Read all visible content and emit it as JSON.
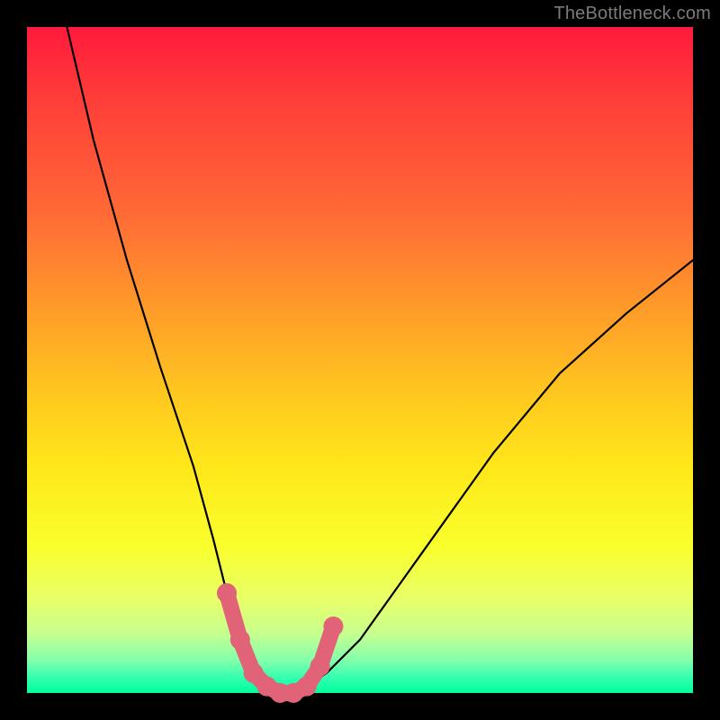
{
  "watermark": "TheBottleneck.com",
  "chart_data": {
    "type": "line",
    "title": "",
    "xlabel": "",
    "ylabel": "",
    "xlim": [
      0,
      100
    ],
    "ylim": [
      0,
      100
    ],
    "series": [
      {
        "name": "bottleneck-curve",
        "x": [
          6,
          10,
          15,
          20,
          25,
          28,
          30,
          32,
          34,
          36,
          38,
          40,
          42,
          45,
          50,
          55,
          60,
          70,
          80,
          90,
          100
        ],
        "values": [
          100,
          83,
          65,
          49,
          34,
          23,
          15,
          8,
          3,
          1,
          0,
          0,
          1,
          3,
          8,
          15,
          22,
          36,
          48,
          57,
          65
        ]
      }
    ],
    "highlight_points": {
      "name": "highlighted-segment",
      "color": "#e06377",
      "x": [
        30,
        32,
        34,
        36,
        38,
        40,
        42,
        44,
        46
      ],
      "values": [
        15,
        8,
        3,
        1,
        0,
        0,
        1,
        4,
        10
      ]
    }
  }
}
